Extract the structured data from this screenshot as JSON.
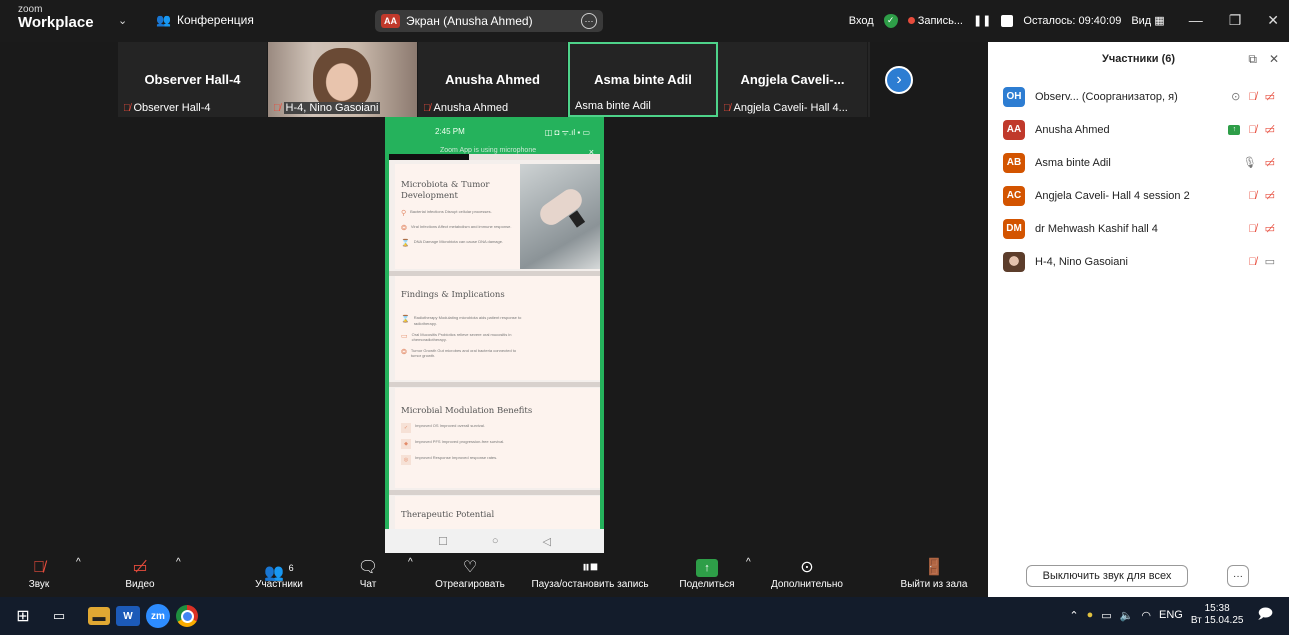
{
  "window": {
    "brand_top": "zoom",
    "brand_bottom": "Workplace",
    "meeting_label": "Конференция",
    "screen_badge": "AA",
    "screen_title": "Экран (Anusha Ahmed)",
    "login": "Вход",
    "record_label": "Запись...",
    "remaining": "Осталось: 09:40:09",
    "view_label": "Вид"
  },
  "strip": {
    "tiles": [
      {
        "name": "Observer  Hall-4",
        "footer": "Observer  Hall-4"
      },
      {
        "name": "",
        "footer": "H-4, Nino Gasoiani"
      },
      {
        "name": "Anusha Ahmed",
        "footer": "Anusha Ahmed"
      },
      {
        "name": "Asma binte Adil",
        "footer": "Asma binte Adil"
      },
      {
        "name": "Angjela Caveli-...",
        "footer": "Angjela Caveli- Hall 4..."
      }
    ]
  },
  "phone": {
    "time": "2:45 PM",
    "status_icons": "◫ ◘ ᯤ.ıl ▪ ▭",
    "banner": "Zoom App is using microphone",
    "banner_close": "×",
    "progress": 0.38,
    "slides": [
      {
        "title": "Microbiota & Tumor Development",
        "rows": [
          {
            "icon": "⚲",
            "text": "Bacterial infections Disrupt cellular processes."
          },
          {
            "icon": "❂",
            "text": "Viral Infections Affect metabolism and immune response."
          },
          {
            "icon": "⌛",
            "text": "DNA Damage Microbiota can cause DNA damage."
          }
        ]
      },
      {
        "title": "Findings & Implications",
        "rows": [
          {
            "icon": "⌛",
            "text": "Radiotherapy Modulating microbiota aids patient response to radiotherapy."
          },
          {
            "icon": "▭",
            "text": "Oral Mucositis Probiotics relieve severe oral mucositis in chemoradiotherapy."
          },
          {
            "icon": "❂",
            "text": "Tumor Growth Gut microbes and oral bacteria connected to tumor growth."
          }
        ]
      },
      {
        "title": "Microbial Modulation Benefits",
        "rows": [
          {
            "icon": "✓",
            "text": "Improved OS Improved overall survival."
          },
          {
            "icon": "◆",
            "text": "Improved PFS Improved progression-free survival."
          },
          {
            "icon": "◎",
            "text": "Improved Response Improved response rates."
          }
        ]
      },
      {
        "title": "Therapeutic Potential",
        "rows": []
      }
    ],
    "nav": [
      "☐",
      "○",
      "◁"
    ]
  },
  "panel": {
    "title": "Участники (6)",
    "participants": [
      {
        "initials": "OH",
        "color": "#2d7dd2",
        "name": "Observ...  (Соорганизатор, я)"
      },
      {
        "initials": "AA",
        "color": "#c0392b",
        "name": "Anusha Ahmed"
      },
      {
        "initials": "AB",
        "color": "#d35400",
        "name": "Asma binte Adil"
      },
      {
        "initials": "AC",
        "color": "#d35400",
        "name": "Angjela Caveli- Hall 4 session 2"
      },
      {
        "initials": "DM",
        "color": "#d35400",
        "name": "dr Mehwash Kashif hall 4"
      },
      {
        "initials": "",
        "color": "#6a4a35",
        "name": "H-4, Nino Gasoiani"
      }
    ],
    "mute_all": "Выключить звук для всех"
  },
  "toolbar": {
    "audio": "Звук",
    "video": "Видео",
    "participants": "Участники",
    "participants_count": "6",
    "chat": "Чат",
    "react": "Отреагировать",
    "pause_record": "Пауза/остановить запись",
    "share": "Поделиться",
    "more": "Дополнительно",
    "leave": "Выйти из зала"
  },
  "taskbar": {
    "lang": "ENG",
    "time": "15:38",
    "date": "Вт 15.04.25",
    "word_label": "W",
    "zoom_label": "zm"
  }
}
